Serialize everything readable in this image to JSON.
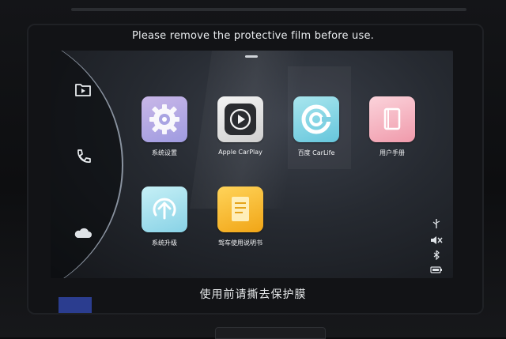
{
  "notices": {
    "top": "Please remove the protective film before use.",
    "bottom": "使用前请撕去保护膜"
  },
  "sidebar": {
    "items": [
      {
        "name": "media",
        "icon": "play-folder-icon"
      },
      {
        "name": "phone",
        "icon": "phone-icon"
      },
      {
        "name": "cloud",
        "icon": "cloud-icon"
      }
    ]
  },
  "apps": [
    {
      "label": "系统设置",
      "icon": "gear-icon"
    },
    {
      "label": "Apple CarPlay",
      "icon": "carplay-icon"
    },
    {
      "label": "百度 CarLife",
      "icon": "carlife-icon"
    },
    {
      "label": "用户手册",
      "icon": "book-icon"
    },
    {
      "label": "系统升级",
      "icon": "upgrade-icon"
    },
    {
      "label": "驾车使用说明书",
      "icon": "guide-book-icon"
    }
  ],
  "status_bar": {
    "icons": [
      "usb-icon",
      "mute-icon",
      "bluetooth-icon",
      "battery-icon"
    ]
  },
  "colors": {
    "screen_bg": "#262a31",
    "text": "#f2f3f5",
    "accent_carlife": "#66c6dc",
    "accent_guide": "#f1a516"
  }
}
